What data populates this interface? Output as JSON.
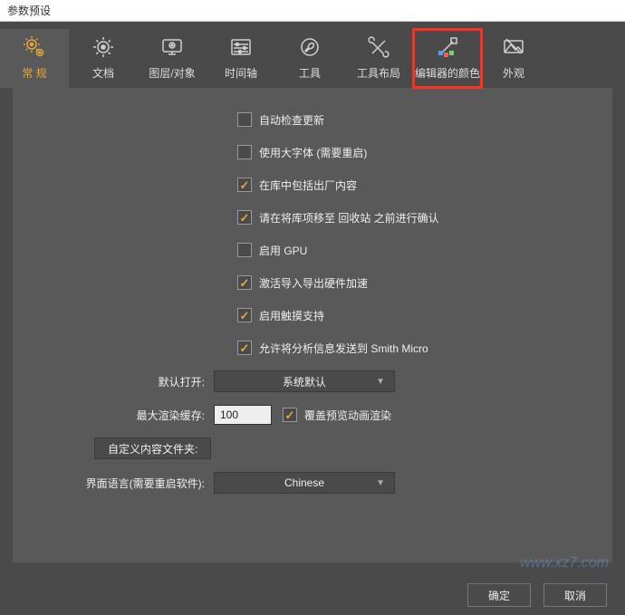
{
  "window": {
    "title": "参数预设"
  },
  "tabs": [
    {
      "label": "常 规",
      "icon": "gears"
    },
    {
      "label": "文档",
      "icon": "gear"
    },
    {
      "label": "图层/对象",
      "icon": "monitor"
    },
    {
      "label": "时间轴",
      "icon": "sliders"
    },
    {
      "label": "工具",
      "icon": "wrench"
    },
    {
      "label": "工具布局",
      "icon": "tools"
    },
    {
      "label": "编辑器的颜色",
      "icon": "palette"
    },
    {
      "label": "外观",
      "icon": "appearance"
    }
  ],
  "active_tab": 0,
  "highlighted_tab": 6,
  "checkboxes": [
    {
      "label": "自动检查更新",
      "checked": false
    },
    {
      "label": "使用大字体 (需要重启)",
      "checked": false
    },
    {
      "label": "在库中包括出厂内容",
      "checked": true
    },
    {
      "label": "请在将库项移至 回收站 之前进行确认",
      "checked": true
    },
    {
      "label": "启用 GPU",
      "checked": false
    },
    {
      "label": "激活导入导出硬件加速",
      "checked": true
    },
    {
      "label": "启用触摸支持",
      "checked": true
    },
    {
      "label": "允许将分析信息发送到 Smith Micro",
      "checked": true
    }
  ],
  "fields": {
    "default_open_label": "默认打开:",
    "default_open_value": "系统默认",
    "max_cache_label": "最大渲染缓存:",
    "max_cache_value": "100",
    "override_preview_label": "覆盖预览动画渲染",
    "override_preview_checked": true,
    "custom_folder_btn": "自定义内容文件夹:",
    "ui_lang_label": "界面语言(需要重启软件):",
    "ui_lang_value": "Chinese"
  },
  "footer": {
    "ok": "确定",
    "cancel": "取消"
  },
  "icon_color_default": "#cfcfcf",
  "icon_color_active": "#e8a838"
}
